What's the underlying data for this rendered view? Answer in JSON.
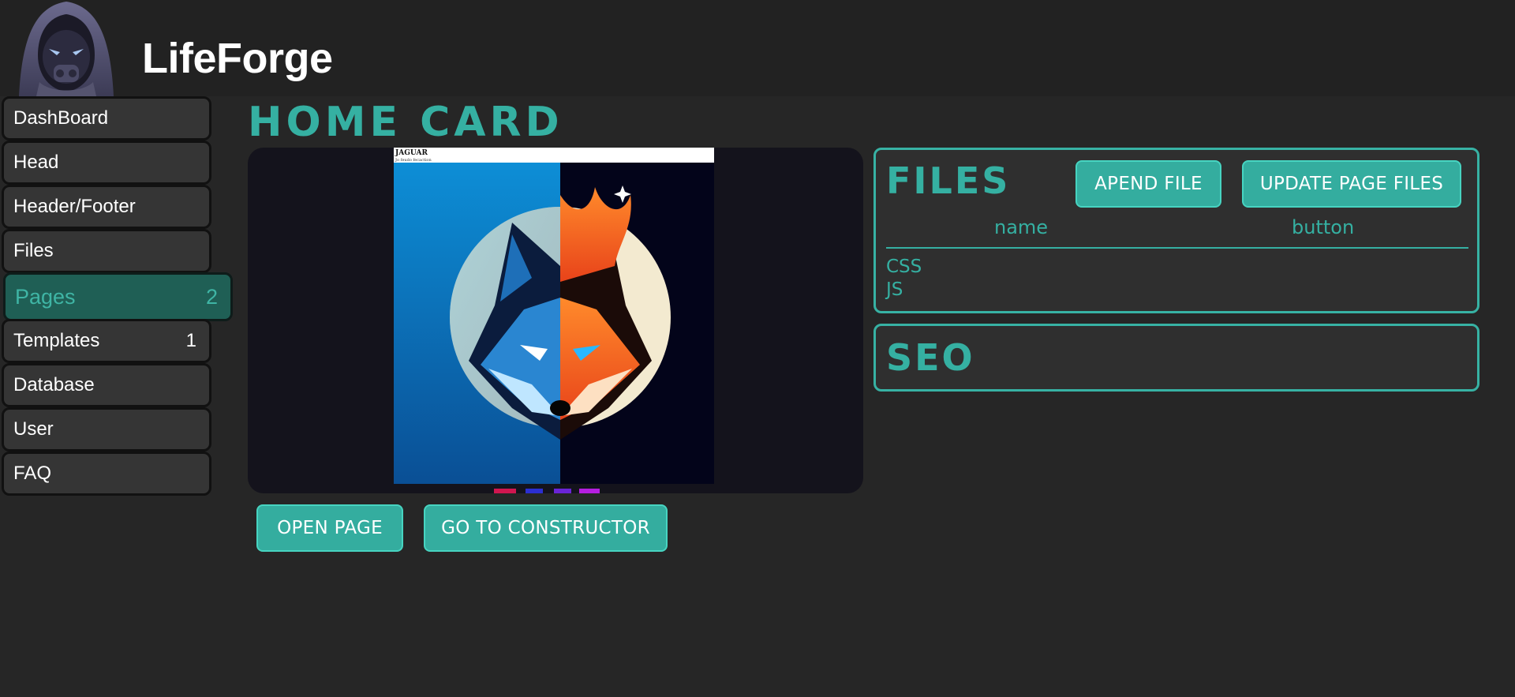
{
  "app": {
    "name": "LifeForge"
  },
  "sidebar": {
    "items": [
      {
        "label": "DashBoard",
        "count": ""
      },
      {
        "label": "Head",
        "count": ""
      },
      {
        "label": "Header/Footer",
        "count": ""
      },
      {
        "label": "Files",
        "count": ""
      },
      {
        "label": "Pages",
        "count": "2",
        "active": true
      },
      {
        "label": "Templates",
        "count": "1"
      },
      {
        "label": "Database",
        "count": ""
      },
      {
        "label": "User",
        "count": ""
      },
      {
        "label": "FAQ",
        "count": ""
      }
    ]
  },
  "main": {
    "title": "HOME CARD",
    "preview": {
      "caption_title": "JAGUAR",
      "caption_sub": "Jo feudo fecaction"
    },
    "open_page_label": "OPEN PAGE",
    "constructor_label": "GO TO CONSTRUCTOR"
  },
  "files_panel": {
    "title": "FILES",
    "append_label": "APEND FILE",
    "update_label": "UPDATE PAGE FILES",
    "columns": [
      "name",
      "button"
    ],
    "rows": [
      "CSS",
      "JS"
    ]
  },
  "seo_panel": {
    "title": "SEO"
  },
  "colors": {
    "accent": "#35b0a2",
    "button": "#34ad9f",
    "background": "#262626",
    "sidebar_item": "#353535",
    "active_item": "#1f5f55"
  }
}
